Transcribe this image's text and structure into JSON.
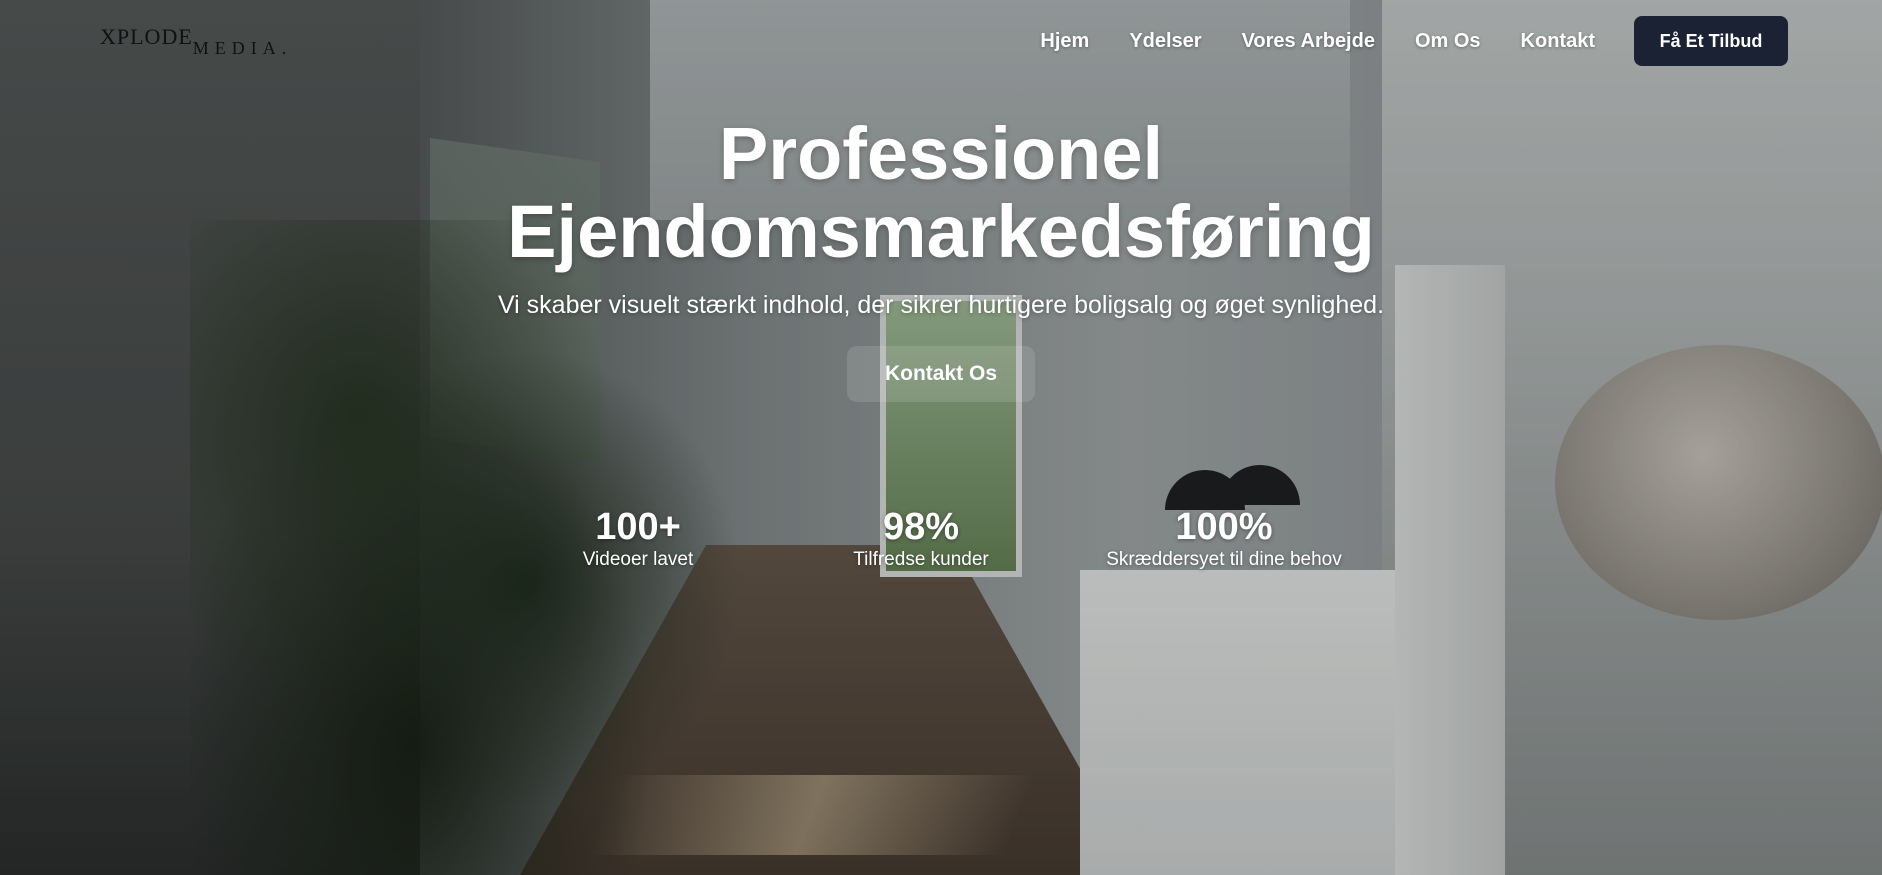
{
  "header": {
    "logo_part1": "XPLODE",
    "logo_part2": "MEDIA.",
    "nav": [
      {
        "label": "Hjem"
      },
      {
        "label": "Ydelser"
      },
      {
        "label": "Vores Arbejde"
      },
      {
        "label": "Om Os"
      },
      {
        "label": "Kontakt"
      }
    ],
    "cta_label": "Få Et Tilbud"
  },
  "hero": {
    "title_line1": "Professionel",
    "title_line2": "Ejendomsmarkedsføring",
    "subtitle": "Vi skaber visuelt stærkt indhold, der sikrer hurtigere boligsalg og øget synlighed.",
    "button_label": "Kontakt Os"
  },
  "stats": [
    {
      "value": "100+",
      "label": "Videoer lavet"
    },
    {
      "value": "98%",
      "label": "Tilfredse kunder"
    },
    {
      "value": "100%",
      "label": "Skræddersyet til dine behov"
    }
  ],
  "colors": {
    "cta_background": "#1a2233",
    "text": "#ffffff",
    "logo": "#111111"
  }
}
